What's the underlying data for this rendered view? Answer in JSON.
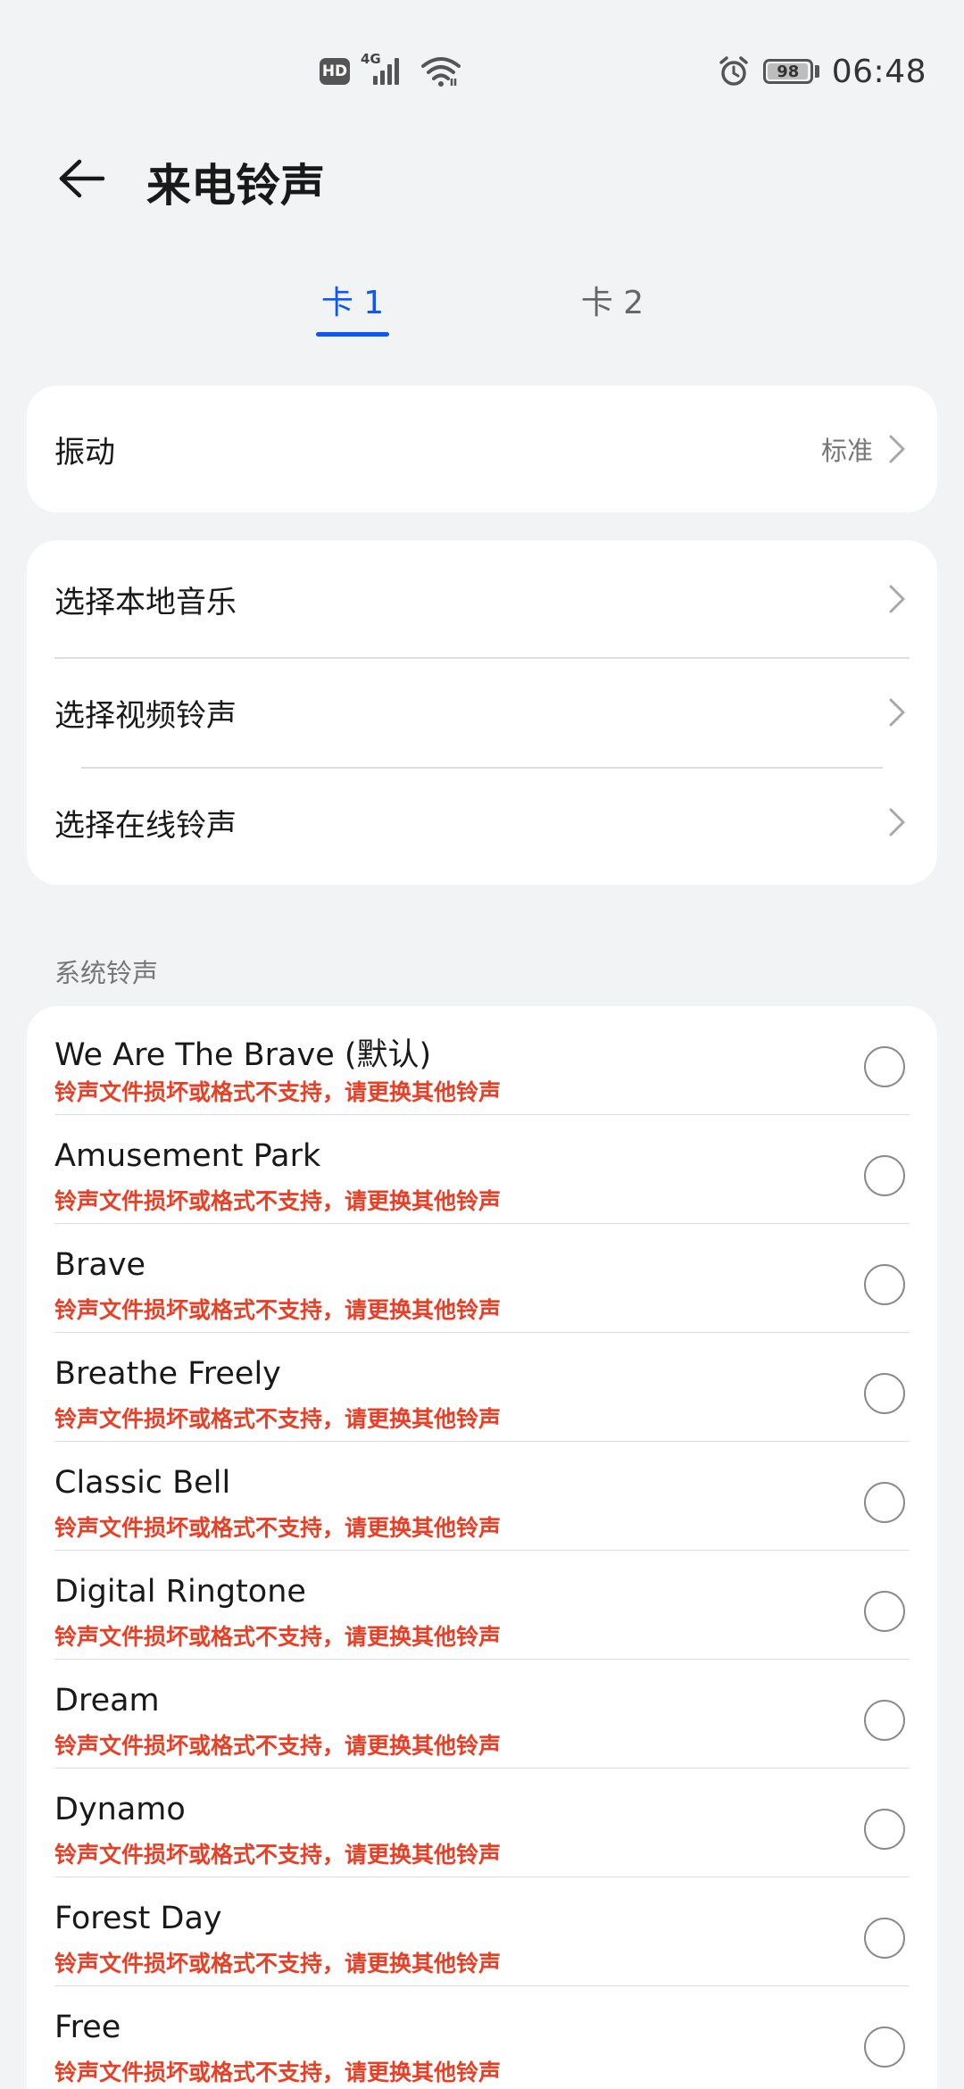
{
  "status_bar": {
    "hd": "HD",
    "network": "4G",
    "battery_level": "98",
    "battery_fraction": 0.98,
    "time": "06:48"
  },
  "header": {
    "title": "来电铃声"
  },
  "tabs": [
    {
      "label": "卡 1",
      "selected": true
    },
    {
      "label": "卡 2",
      "selected": false
    }
  ],
  "vibration": {
    "label": "振动",
    "value": "标准"
  },
  "choose_options": [
    {
      "label": "选择本地音乐"
    },
    {
      "label": "选择视频铃声"
    },
    {
      "label": "选择在线铃声"
    }
  ],
  "system_section": {
    "title": "系统铃声",
    "ringtones": [
      {
        "name": "We Are The Brave (默认)",
        "error": "铃声文件损坏或格式不支持，请更换其他铃声"
      },
      {
        "name": "Amusement Park",
        "error": "铃声文件损坏或格式不支持，请更换其他铃声"
      },
      {
        "name": "Brave",
        "error": "铃声文件损坏或格式不支持，请更换其他铃声"
      },
      {
        "name": "Breathe Freely",
        "error": "铃声文件损坏或格式不支持，请更换其他铃声"
      },
      {
        "name": "Classic Bell",
        "error": "铃声文件损坏或格式不支持，请更换其他铃声"
      },
      {
        "name": "Digital Ringtone",
        "error": "铃声文件损坏或格式不支持，请更换其他铃声"
      },
      {
        "name": "Dream",
        "error": "铃声文件损坏或格式不支持，请更换其他铃声"
      },
      {
        "name": "Dynamo",
        "error": "铃声文件损坏或格式不支持，请更换其他铃声"
      },
      {
        "name": "Forest Day",
        "error": "铃声文件损坏或格式不支持，请更换其他铃声"
      },
      {
        "name": "Free",
        "error": "铃声文件损坏或格式不支持，请更换其他铃声"
      }
    ]
  },
  "colors": {
    "accent": "#0A59F7",
    "error": "#E84026",
    "background": "#F1F3F5"
  },
  "icons": {
    "back": "arrow-left-icon",
    "chevron": "chevron-right-icon",
    "alarm": "alarm-icon",
    "wifi": "wifi-icon",
    "signal": "signal-icon"
  }
}
